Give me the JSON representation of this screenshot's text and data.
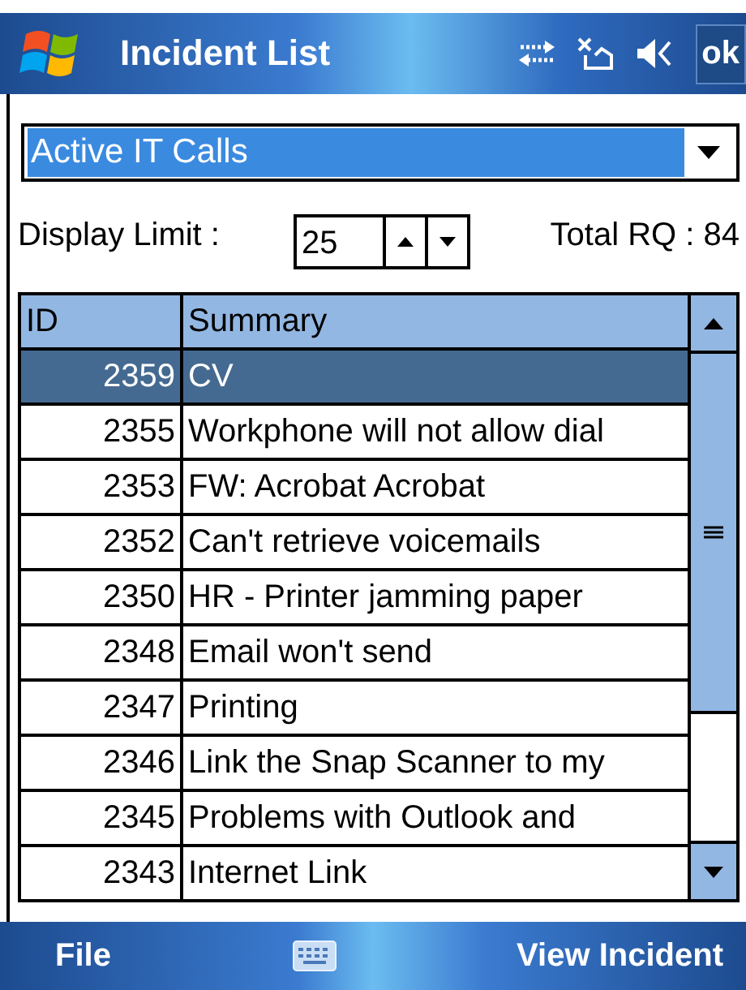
{
  "title_bar": {
    "title": "Incident List",
    "ok": "ok"
  },
  "filter": {
    "value": "Active IT Calls"
  },
  "display_limit": {
    "label": "Display Limit :",
    "value": "25"
  },
  "total": "Total RQ : 84",
  "table": {
    "columns": [
      "ID",
      "Summary"
    ],
    "rows": [
      {
        "id": "2359",
        "summary": "CV",
        "selected": true
      },
      {
        "id": "2355",
        "summary": "Workphone will not allow dial",
        "selected": false
      },
      {
        "id": "2353",
        "summary": "FW: Acrobat Acrobat",
        "selected": false
      },
      {
        "id": "2352",
        "summary": "Can't retrieve voicemails",
        "selected": false
      },
      {
        "id": "2350",
        "summary": "HR - Printer jamming paper",
        "selected": false
      },
      {
        "id": "2348",
        "summary": "Email won't send",
        "selected": false
      },
      {
        "id": "2347",
        "summary": "Printing",
        "selected": false
      },
      {
        "id": "2346",
        "summary": "Link the Snap Scanner to my",
        "selected": false
      },
      {
        "id": "2345",
        "summary": "Problems with Outlook and",
        "selected": false
      },
      {
        "id": "2343",
        "summary": "Internet Link",
        "selected": false
      }
    ]
  },
  "menu_bar": {
    "left": "File",
    "right": "View Incident"
  }
}
